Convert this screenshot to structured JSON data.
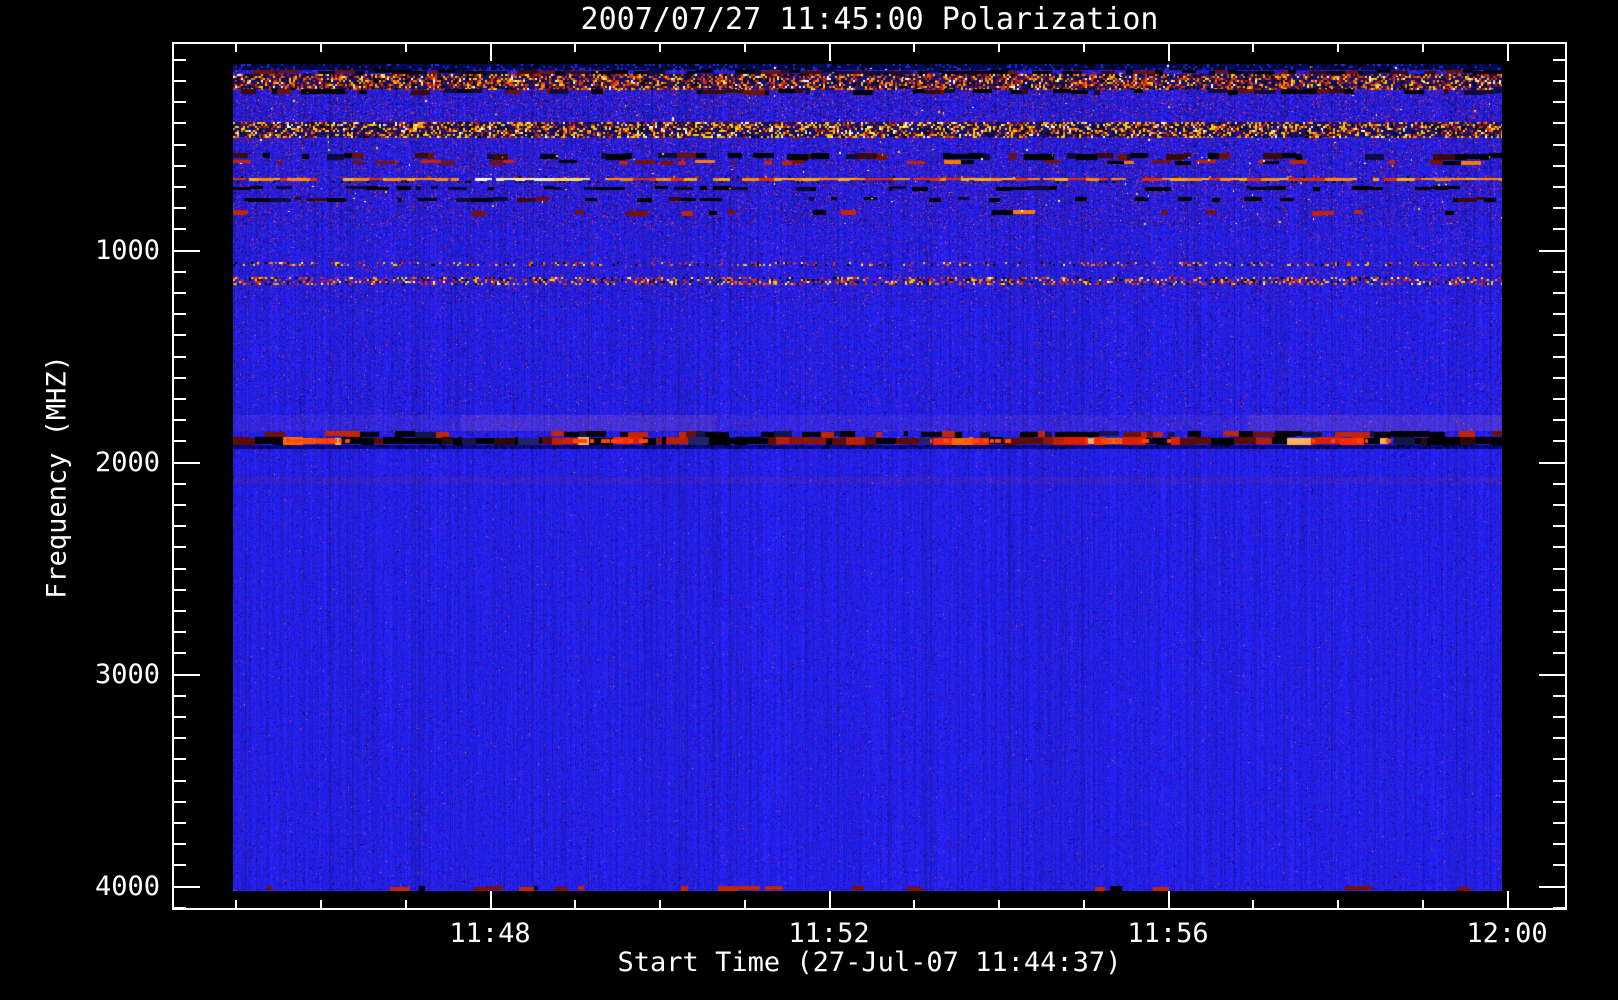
{
  "title": "2007/07/27 11:45:00 Polarization",
  "chart_data": {
    "type": "heatmap",
    "title": "2007/07/27 11:45:00 Polarization",
    "xlabel": "Start Time (27-Jul-07 11:44:37)",
    "ylabel": "Frequency (MHZ)",
    "x_tick_labels": [
      "11:48",
      "11:52",
      "11:56",
      "12:00"
    ],
    "y_tick_labels": [
      "1000",
      "2000",
      "3000",
      "4000"
    ],
    "y_tick_values_mhz": [
      1000,
      2000,
      3000,
      4000
    ],
    "x_minor_tick_interval": "1 min",
    "y_minor_tick_interval_mhz": 100,
    "time_range": [
      "11:45:00",
      "12:00:00"
    ],
    "freq_range_mhz": [
      120,
      4020
    ],
    "grid": false,
    "legend": false,
    "frame_color": "#ffffff",
    "background_color": "#2220ee",
    "palette": {
      "background": "#2220ee",
      "background_dark": "#140da8",
      "red": "#e03000",
      "dark_red": "#7a1200",
      "orange": "#ff7b00",
      "yellow": "#ffd000",
      "white": "#ffffff",
      "black": "#000000",
      "navy": "#000a55",
      "pink": "#ff96aa"
    },
    "bands": [
      {
        "f0": 120,
        "f1": 150,
        "style": "navy_band"
      },
      {
        "f0": 150,
        "f1": 168,
        "style": "dark_dash",
        "density": 0.7
      },
      {
        "f0": 168,
        "f1": 240,
        "style": "bright_mix",
        "variant": "red"
      },
      {
        "f0": 240,
        "f1": 263,
        "style": "dark_dash",
        "density": 0.5
      },
      {
        "f0": 394,
        "f1": 466,
        "style": "bright_mix",
        "variant": "yellow"
      },
      {
        "f0": 540,
        "f1": 570,
        "style": "dark_dash",
        "density": 0.5
      },
      {
        "f0": 573,
        "f1": 590,
        "style": "red_dash",
        "density": 0.4
      },
      {
        "f0": 648,
        "f1": 678,
        "style": "bright_streak",
        "hot": [
          0.19,
          0.29
        ]
      },
      {
        "f0": 695,
        "f1": 715,
        "style": "black_dash",
        "density": 0.5
      },
      {
        "f0": 747,
        "f1": 766,
        "style": "dark_dash",
        "density": 0.35
      },
      {
        "f0": 809,
        "f1": 832,
        "style": "red_dash",
        "density": 0.25
      },
      {
        "f0": 1054,
        "f1": 1073,
        "style": "speckle_line",
        "density": 0.22
      },
      {
        "f0": 1125,
        "f1": 1158,
        "style": "speckle_line",
        "density": 0.38
      },
      {
        "f0": 1776,
        "f1": 1851,
        "style": "pink_haze",
        "hotspots": [
          [
            0.18,
            0.38
          ],
          [
            0.8,
            1.0
          ]
        ]
      },
      {
        "f0": 1851,
        "f1": 1878,
        "style": "main_dash",
        "density": 0.6
      },
      {
        "f0": 1878,
        "f1": 1916,
        "style": "main_line",
        "hotspots": [
          [
            0.04,
            0.09
          ],
          [
            0.26,
            0.33
          ],
          [
            0.55,
            0.61
          ],
          [
            0.66,
            0.75
          ],
          [
            0.84,
            0.91
          ]
        ],
        "dark_zones": [
          [
            0.12,
            0.22
          ],
          [
            0.92,
            1.0
          ]
        ]
      },
      {
        "f0": 1916,
        "f1": 1936,
        "style": "navy_row"
      },
      {
        "f0": 2068,
        "f1": 2101,
        "style": "faint_red"
      },
      {
        "f0": 3998,
        "f1": 4020,
        "style": "red_dash",
        "density": 0.18
      }
    ],
    "noise_profile": [
      {
        "f0": 120,
        "f1": 400,
        "red": 0.1,
        "dark": 0.3
      },
      {
        "f0": 400,
        "f1": 880,
        "red": 0.085,
        "dark": 0.22
      },
      {
        "f0": 880,
        "f1": 1250,
        "red": 0.05,
        "dark": 0.15
      },
      {
        "f0": 1250,
        "f1": 1720,
        "red": 0.025,
        "dark": 0.11
      },
      {
        "f0": 1720,
        "f1": 1940,
        "red": 0.02,
        "dark": 0.08
      },
      {
        "f0": 1940,
        "f1": 4020,
        "red": 0.007,
        "dark": 0.06
      }
    ]
  }
}
